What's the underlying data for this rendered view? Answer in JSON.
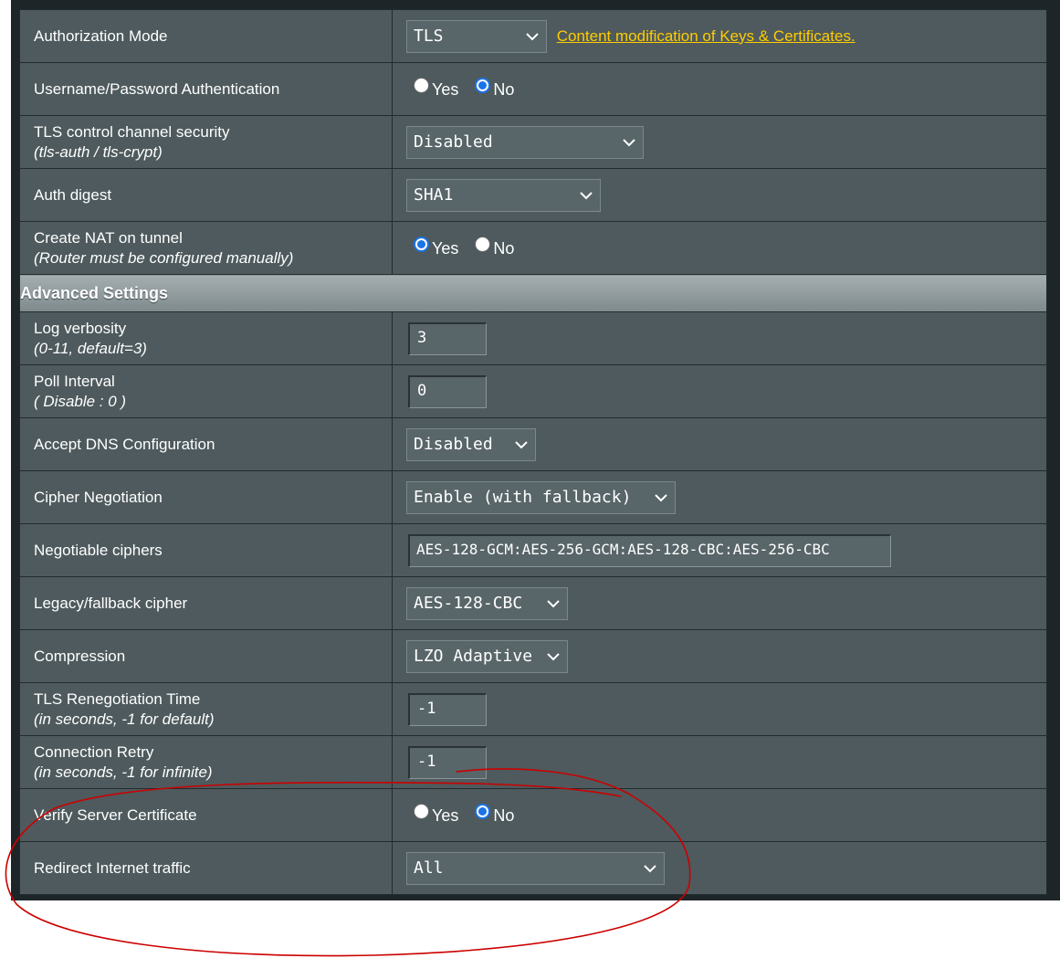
{
  "rows_top": [
    {
      "label": "Authorization Mode",
      "control": "select",
      "value": "TLS",
      "link": "Content modification of Keys & Certificates."
    },
    {
      "label": "Username/Password Authentication",
      "control": "radio",
      "options": [
        "Yes",
        "No"
      ],
      "selected": "No"
    },
    {
      "label": "TLS control channel security",
      "sub": "(tls-auth / tls-crypt)",
      "control": "select",
      "value": "Disabled"
    },
    {
      "label": "Auth digest",
      "control": "select",
      "value": "SHA1"
    },
    {
      "label": "Create NAT on tunnel",
      "sub": "(Router must be configured manually)",
      "control": "radio",
      "options": [
        "Yes",
        "No"
      ],
      "selected": "Yes"
    }
  ],
  "section_title": "Advanced Settings",
  "rows_adv": [
    {
      "label": "Log verbosity",
      "sub": "(0-11, default=3)",
      "control": "input",
      "value": "3"
    },
    {
      "label": "Poll Interval",
      "sub": "( Disable : 0 )",
      "control": "input",
      "value": "0"
    },
    {
      "label": "Accept DNS Configuration",
      "control": "select",
      "value": "Disabled"
    },
    {
      "label": "Cipher Negotiation",
      "control": "select",
      "value": "Enable (with fallback)"
    },
    {
      "label": "Negotiable ciphers",
      "control": "input",
      "value": "AES-128-GCM:AES-256-GCM:AES-128-CBC:AES-256-CBC"
    },
    {
      "label": "Legacy/fallback cipher",
      "control": "select",
      "value": "AES-128-CBC"
    },
    {
      "label": "Compression",
      "control": "select",
      "value": "LZO Adaptive"
    },
    {
      "label": "TLS Renegotiation Time",
      "sub": "(in seconds, -1 for default)",
      "control": "input",
      "value": "-1"
    },
    {
      "label": "Connection Retry",
      "sub": "(in seconds, -1 for infinite)",
      "control": "input",
      "value": "-1"
    },
    {
      "label": "Verify Server Certificate",
      "control": "radio",
      "options": [
        "Yes",
        "No"
      ],
      "selected": "No"
    },
    {
      "label": "Redirect Internet traffic",
      "control": "select",
      "value": "All"
    }
  ],
  "colors": {
    "panel": "#4e5a5d",
    "accent_link": "#ffcc00",
    "radio_selected": "#1a73e8",
    "annotation": "#cc0000"
  }
}
